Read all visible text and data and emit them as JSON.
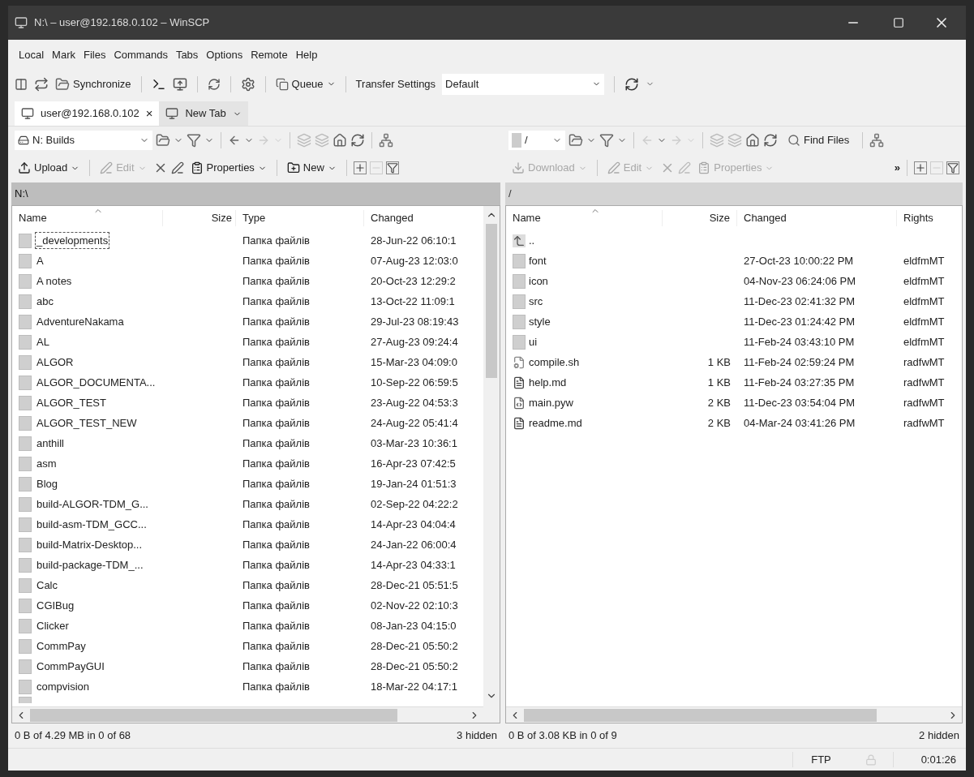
{
  "window": {
    "title": "N:\\ – user@192.168.0.102 – WinSCP"
  },
  "menu": [
    "Local",
    "Mark",
    "Files",
    "Commands",
    "Tabs",
    "Options",
    "Remote",
    "Help"
  ],
  "toolbar": {
    "synchronize": "Synchronize",
    "queue": "Queue",
    "transfer_settings": "Transfer Settings",
    "preset": "Default"
  },
  "tabs": [
    {
      "label": "user@192.168.0.102",
      "selected": true,
      "close": "×"
    },
    {
      "label": "New Tab",
      "selected": false
    }
  ],
  "left_panel": {
    "active": true,
    "location": "N: Builds",
    "path": "N:\\",
    "actions": [
      {
        "label": "Upload",
        "disabled": false
      },
      {
        "label": "Edit",
        "disabled": true
      },
      {
        "label": "Properties",
        "disabled": false
      },
      {
        "label": "New",
        "disabled": false
      }
    ],
    "columns": [
      "Name",
      "Size",
      "Type",
      "Changed"
    ],
    "rows": [
      {
        "kind": "folder",
        "name": "_developments",
        "type": "Папка файлів",
        "changed": "28-Jun-22 06:10:1",
        "focused": true
      },
      {
        "kind": "folder",
        "name": "A",
        "type": "Папка файлів",
        "changed": "07-Aug-23 12:03:0",
        "focused": false
      },
      {
        "kind": "folder",
        "name": "A notes",
        "type": "Папка файлів",
        "changed": "20-Oct-23 12:29:2",
        "focused": false
      },
      {
        "kind": "folder",
        "name": "abc",
        "type": "Папка файлів",
        "changed": "13-Oct-22 11:09:1",
        "focused": false
      },
      {
        "kind": "folder",
        "name": "AdventureNakama",
        "type": "Папка файлів",
        "changed": "29-Jul-23 08:19:43",
        "focused": false
      },
      {
        "kind": "folder",
        "name": "AL",
        "type": "Папка файлів",
        "changed": "27-Aug-23 09:24:4",
        "focused": false
      },
      {
        "kind": "folder",
        "name": "ALGOR",
        "type": "Папка файлів",
        "changed": "15-Mar-23 04:09:0",
        "focused": false
      },
      {
        "kind": "folder",
        "name": "ALGOR_DOCUMENTA...",
        "type": "Папка файлів",
        "changed": "10-Sep-22 06:59:5",
        "focused": false
      },
      {
        "kind": "folder",
        "name": "ALGOR_TEST",
        "type": "Папка файлів",
        "changed": "23-Aug-22 04:53:3",
        "focused": false
      },
      {
        "kind": "folder",
        "name": "ALGOR_TEST_NEW",
        "type": "Папка файлів",
        "changed": "24-Aug-22 05:41:4",
        "focused": false
      },
      {
        "kind": "folder",
        "name": "anthill",
        "type": "Папка файлів",
        "changed": "03-Mar-23 10:36:1",
        "focused": false
      },
      {
        "kind": "folder",
        "name": "asm",
        "type": "Папка файлів",
        "changed": "16-Apr-23 07:42:5",
        "focused": false
      },
      {
        "kind": "folder",
        "name": "Blog",
        "type": "Папка файлів",
        "changed": "19-Jan-24 01:51:3",
        "focused": false
      },
      {
        "kind": "folder",
        "name": "build-ALGOR-TDM_G...",
        "type": "Папка файлів",
        "changed": "02-Sep-22 04:22:2",
        "focused": false
      },
      {
        "kind": "folder",
        "name": "build-asm-TDM_GCC...",
        "type": "Папка файлів",
        "changed": "14-Apr-23 04:04:4",
        "focused": false
      },
      {
        "kind": "folder",
        "name": "build-Matrix-Desktop...",
        "type": "Папка файлів",
        "changed": "24-Jan-22 06:00:4",
        "focused": false
      },
      {
        "kind": "folder",
        "name": "build-package-TDM_...",
        "type": "Папка файлів",
        "changed": "14-Apr-23 04:33:1",
        "focused": false
      },
      {
        "kind": "folder",
        "name": "Calc",
        "type": "Папка файлів",
        "changed": "28-Dec-21 05:51:5",
        "focused": false
      },
      {
        "kind": "folder",
        "name": "CGIBug",
        "type": "Папка файлів",
        "changed": "02-Nov-22 02:10:3",
        "focused": false
      },
      {
        "kind": "folder",
        "name": "Clicker",
        "type": "Папка файлів",
        "changed": "08-Jan-23 04:15:0",
        "focused": false
      },
      {
        "kind": "folder",
        "name": "CommPay",
        "type": "Папка файлів",
        "changed": "28-Dec-21 05:50:2",
        "focused": false
      },
      {
        "kind": "folder",
        "name": "CommPayGUI",
        "type": "Папка файлів",
        "changed": "28-Dec-21 05:50:2",
        "focused": false
      },
      {
        "kind": "folder",
        "name": "compvision",
        "type": "Папка файлів",
        "changed": "18-Mar-22 04:17:1",
        "focused": false
      }
    ],
    "status": "0 B of 4.29 MB in 0 of 68",
    "hidden": "3 hidden"
  },
  "right_panel": {
    "active": false,
    "location": "/",
    "path": "/",
    "find_files": "Find Files",
    "more": "»",
    "actions": [
      {
        "label": "Download",
        "disabled": true
      },
      {
        "label": "Edit",
        "disabled": true
      },
      {
        "label": "Properties",
        "disabled": true
      }
    ],
    "columns": [
      "Name",
      "Size",
      "Changed",
      "Rights"
    ],
    "rows": [
      {
        "kind": "parent",
        "name": ".."
      },
      {
        "kind": "folder",
        "name": "font",
        "changed": "27-Oct-23 10:00:22 PM",
        "rights": "eldfmMT"
      },
      {
        "kind": "folder",
        "name": "icon",
        "changed": "04-Nov-23 06:24:06 PM",
        "rights": "eldfmMT"
      },
      {
        "kind": "folder",
        "name": "src",
        "changed": "11-Dec-23 02:41:32 PM",
        "rights": "eldfmMT"
      },
      {
        "kind": "folder",
        "name": "style",
        "changed": "11-Dec-23 01:24:42 PM",
        "rights": "eldfmMT"
      },
      {
        "kind": "folder",
        "name": "ui",
        "changed": "11-Feb-24 03:43:10 PM",
        "rights": "eldfmMT"
      },
      {
        "kind": "script",
        "name": "compile.sh",
        "size": "1 KB",
        "changed": "11-Feb-24 02:59:24 PM",
        "rights": "radfwMT"
      },
      {
        "kind": "text",
        "name": "help.md",
        "size": "1 KB",
        "changed": "11-Feb-24 03:27:35 PM",
        "rights": "radfwMT"
      },
      {
        "kind": "python",
        "name": "main.pyw",
        "size": "2 KB",
        "changed": "11-Dec-23 03:54:04 PM",
        "rights": "radfwMT"
      },
      {
        "kind": "text",
        "name": "readme.md",
        "size": "2 KB",
        "changed": "04-Mar-24 03:41:26 PM",
        "rights": "radfwMT"
      }
    ],
    "status": "0 B of 3.08 KB in 0 of 9",
    "hidden": "2 hidden"
  },
  "status_bar": {
    "protocol": "FTP",
    "time": "0:01:26"
  }
}
